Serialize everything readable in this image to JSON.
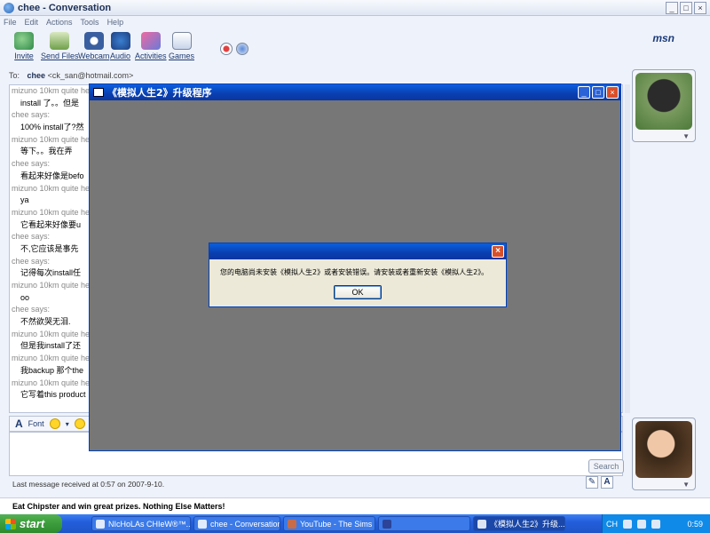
{
  "msn": {
    "title": "chee - Conversation",
    "menu": [
      "File",
      "Edit",
      "Actions",
      "Tools",
      "Help"
    ],
    "toolbar": [
      "Invite",
      "Send Files",
      "Webcam",
      "Audio",
      "Activities",
      "Games"
    ],
    "logo": "msn",
    "to_label": "To:",
    "to_name": "chee",
    "to_email": "<ck_san@hotmail.com>",
    "messages": [
      {
        "sender": "mizuno 10km quite he",
        "text": "install 了。。但是"
      },
      {
        "sender": "chee says:",
        "text": "100% install了?然"
      },
      {
        "sender": "mizuno 10km quite he",
        "text": "等下。。我在弄"
      },
      {
        "sender": "chee says:",
        "text": "看起来好像是befo"
      },
      {
        "sender": "mizuno 10km quite he",
        "text": "ya"
      },
      {
        "sender": "mizuno 10km quite he",
        "text": "它看起来好像要u"
      },
      {
        "sender": "chee says:",
        "text": "不,它应该是事先"
      },
      {
        "sender": "chee says:",
        "text": "记得每次install任"
      },
      {
        "sender": "mizuno 10km quite he",
        "text": "oo"
      },
      {
        "sender": "chee says:",
        "text": "不然欲哭无泪."
      },
      {
        "sender": "mizuno 10km quite he",
        "text": "但是我install了还"
      },
      {
        "sender": "mizuno 10km quite he",
        "text": "我backup 那个the"
      },
      {
        "sender": "mizuno 10km quite he",
        "text": "它写着this product"
      }
    ],
    "format": {
      "font_label": "Font",
      "extra_label": "W"
    },
    "search_label": "Search",
    "status": "Last message received at 0:57 on 2007-9-10.",
    "ad": "Eat Chipster and win great prizes. Nothing Else Matters!"
  },
  "installer": {
    "title": "《模拟人生2》升级程序"
  },
  "dialog": {
    "message": "您的电脑尚未安装《模拟人生2》或者安装错误。请安装或者重新安装《模拟人生2》。",
    "ok_label": "OK"
  },
  "taskbar": {
    "start_label": "start",
    "items": [
      {
        "label": "NIcHoLAs CHIeW®™..."
      },
      {
        "label": "chee - Conversation"
      },
      {
        "label": "YouTube - The Sims 2..."
      },
      {
        "label": ""
      },
      {
        "label": "《模拟人生2》升级..."
      }
    ],
    "language": "CH",
    "clock": "0:59"
  }
}
